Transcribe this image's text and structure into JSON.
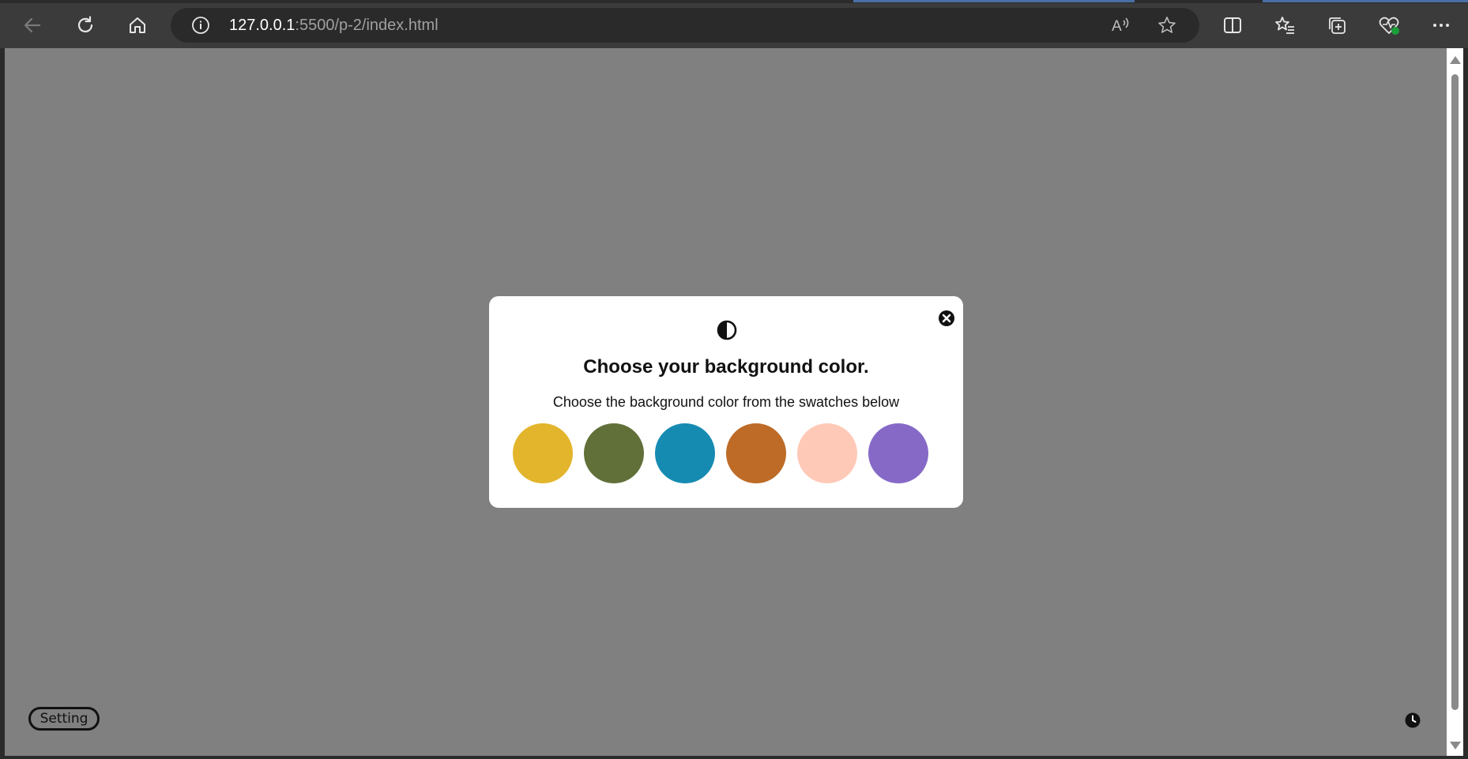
{
  "browser": {
    "url_host": "127.0.0.1",
    "url_rest": ":5500/p-2/index.html",
    "icons": [
      "back-icon",
      "refresh-icon",
      "home-icon",
      "info-icon",
      "read-aloud-icon",
      "favorite-star-icon",
      "split-screen-icon",
      "favorites-icon",
      "collections-icon",
      "browser-essentials-icon",
      "more-icon"
    ]
  },
  "modal": {
    "icon": "contrast-icon",
    "title": "Choose your background color.",
    "subtitle": "Choose the background color from the swatches below",
    "close_icon": "close-icon",
    "swatches": [
      {
        "color": "#E2B52C"
      },
      {
        "color": "#617039"
      },
      {
        "color": "#168BB2"
      },
      {
        "color": "#BD6B27"
      },
      {
        "color": "#FFC9B7"
      },
      {
        "color": "#8669C7"
      }
    ]
  },
  "page": {
    "background": "#808080",
    "setting_label": "Setting",
    "clock_icon": "clock-icon"
  }
}
